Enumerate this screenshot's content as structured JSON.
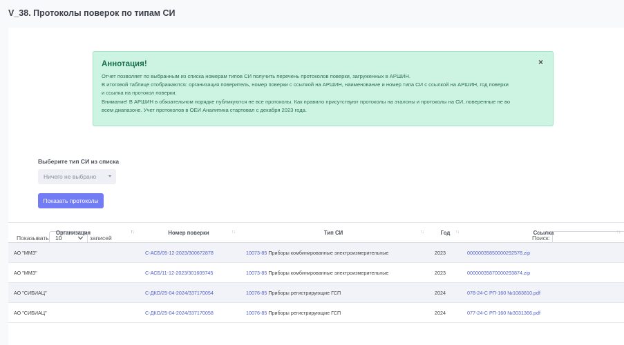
{
  "page": {
    "title": "V_38. Протоколы поверок по типам СИ"
  },
  "annotation": {
    "title": "Аннотация!",
    "lines": [
      "Отчет позволяет по выбранным из списка номерам типов СИ получить перечень протоколов поверки, загруженных в АРШИН.",
      "В итоговой таблице отображаются: организация поверитель, номер поверки с ссылкой на АРШИН, наименование и номер типа СИ с ссылкой на АРШИН, год поверки",
      "и ссылка на протокол поверки.",
      "Внимание! В АРШИН в обязательном порядке публикуются не все протоколы. Как правило присутствуют протоколы на эталоны и протоколы на СИ, поверенные не во",
      "всем диапазоне. Учет протоколов в ОЕИ Аналитика стартовал с декабря 2023 года."
    ],
    "close_label": "×"
  },
  "filter": {
    "label": "Выберите тип СИ из списка",
    "selected": "Ничего не выбрано",
    "button_label": "Показать протоколы"
  },
  "table_controls": {
    "length_prefix": "Показывать",
    "length_value": "10",
    "length_suffix": "записей",
    "search_label": "Поиск:",
    "search_value": ""
  },
  "table": {
    "columns": [
      "Организация",
      "Номер поверки",
      "Тип СИ",
      "Год",
      "Ссылка"
    ],
    "rows": [
      {
        "org": "АО \"ММЗ\"",
        "number": "С-АСБ/05-12-2023/300672878",
        "type_code": "10073-85",
        "type_name": "Приборы комбинированные электроизмерительные",
        "year": "2023",
        "link": "00000035850000292578.zip"
      },
      {
        "org": "АО \"ММЗ\"",
        "number": "С-АСБ/11-12-2023/301609745",
        "type_code": "10073-85",
        "type_name": "Приборы комбинированные электроизмерительные",
        "year": "2023",
        "link": "00000035870000293874.zip"
      },
      {
        "org": "АО \"СИБИАЦ\"",
        "number": "С-ДКО/25-04-2024/337170054",
        "type_code": "10076-85",
        "type_name": "Приборы регистрирующие ГСП",
        "year": "2024",
        "link": "078-24-С РП-160 №1083810.pdf"
      },
      {
        "org": "АО \"СИБИАЦ\"",
        "number": "С-ДКО/25-04-2024/337170058",
        "type_code": "10076-85",
        "type_name": "Приборы регистрирующие ГСП",
        "year": "2024",
        "link": "077-24-С РП-160 №3031366.pdf"
      }
    ]
  },
  "colors": {
    "accent": "#727cf5",
    "alert_bg": "#cdf3e2",
    "link": "#5563c9"
  }
}
